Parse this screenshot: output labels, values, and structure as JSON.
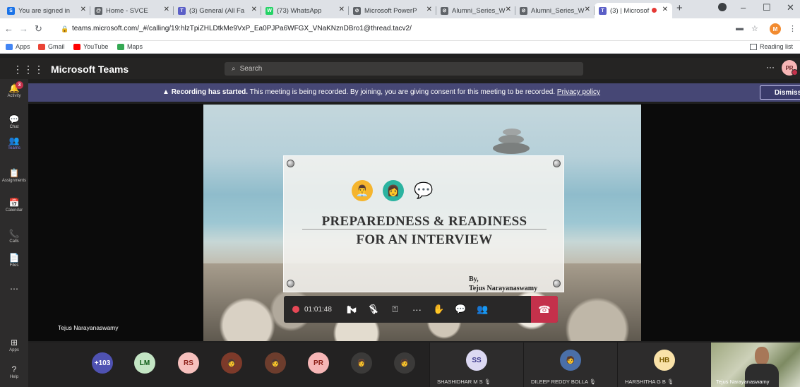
{
  "browser": {
    "tabs": [
      {
        "title": "You are signed in",
        "icon_color": "#1a73e8",
        "icon_letter": "S"
      },
      {
        "title": "Home - SVCE",
        "icon_color": "#5f6368",
        "icon_letter": "@"
      },
      {
        "title": "(3) General (All Fa",
        "icon_color": "#5b5fc7",
        "icon_letter": "T"
      },
      {
        "title": "(73) WhatsApp",
        "icon_color": "#25d366",
        "icon_letter": "W"
      },
      {
        "title": "Microsoft PowerP",
        "icon_color": "#5f6368",
        "icon_letter": "⊘"
      },
      {
        "title": "Alumni_Series_W",
        "icon_color": "#5f6368",
        "icon_letter": "⊘"
      },
      {
        "title": "Alumni_Series_W",
        "icon_color": "#5f6368",
        "icon_letter": "⊘"
      },
      {
        "title": "(3) | Microsof",
        "icon_color": "#5b5fc7",
        "icon_letter": "T"
      }
    ],
    "url": "teams.microsoft.com/_#/calling/19:hlzTpiZHLDtkMe9VxP_Ea0PJPa6WFGX_VNaKNznDBro1@thread.tacv2/",
    "profile_letter": "M",
    "bookmarks": [
      {
        "label": "Apps",
        "color": "#4285f4"
      },
      {
        "label": "Gmail",
        "color": "#ea4335"
      },
      {
        "label": "YouTube",
        "color": "#ff0000"
      },
      {
        "label": "Maps",
        "color": "#34a853"
      }
    ],
    "reading_list": "Reading list"
  },
  "teams": {
    "app_name": "Microsoft Teams",
    "search_placeholder": "Search",
    "user_initials": "PR",
    "rail": [
      {
        "label": "Activity",
        "glyph": "🔔",
        "badge": "3"
      },
      {
        "label": "Chat",
        "glyph": "💬"
      },
      {
        "label": "Teams",
        "glyph": "👥"
      },
      {
        "label": "Assignments",
        "glyph": "📋"
      },
      {
        "label": "Calendar",
        "glyph": "📅"
      },
      {
        "label": "Calls",
        "glyph": "📞"
      },
      {
        "label": "Files",
        "glyph": "📄"
      },
      {
        "label": "",
        "glyph": "⋯"
      },
      {
        "label": "Apps",
        "glyph": "⊞"
      },
      {
        "label": "Help",
        "glyph": "?"
      }
    ],
    "banner": {
      "bold": "Recording has started.",
      "text": "This meeting is being recorded. By joining, you are giving consent for this meeting to be recorded.",
      "link": "Privacy policy",
      "dismiss": "Dismiss"
    },
    "slide": {
      "line1": "PREPAREDNESS & READINESS",
      "line2": "FOR AN INTERVIEW",
      "by": "By,",
      "author": "Tejus Narayanaswamy"
    },
    "presenter_name": "Tejus Narayanaswamy",
    "call_controls": {
      "timer": "01:01:48"
    },
    "participants": [
      {
        "initials": "+103",
        "bg": "#4f52b2",
        "fg": "#ffffff"
      },
      {
        "initials": "LM",
        "bg": "#c3e5c4",
        "fg": "#0b5a14"
      },
      {
        "initials": "RS",
        "bg": "#f6c0bd",
        "fg": "#8c1f17"
      },
      {
        "initials": "",
        "bg": "#7d3a2a",
        "fg": "#ffffff"
      },
      {
        "initials": "",
        "bg": "#6d3d2d",
        "fg": "#ffffff"
      },
      {
        "initials": "PR",
        "bg": "#f6b6b6",
        "fg": "#8c1f17"
      },
      {
        "initials": "",
        "bg": "#3b3a39",
        "fg": "#ffffff"
      },
      {
        "initials": "",
        "bg": "#3b3a39",
        "fg": "#ffffff"
      }
    ],
    "named_tiles": [
      {
        "initials": "SS",
        "name": "SHASHIDHAR M S",
        "bg": "#dcd9f3",
        "fg": "#3d3a8c"
      },
      {
        "initials": "",
        "name": "DILEEP REDDY BOLLA",
        "bg": "#4a6fa8",
        "fg": "#ffffff"
      },
      {
        "initials": "HB",
        "name": "HARSHITHA G B",
        "bg": "#f9e2a8",
        "fg": "#7a5b00"
      }
    ],
    "video_name": "Tejus Narayanaswamy"
  }
}
